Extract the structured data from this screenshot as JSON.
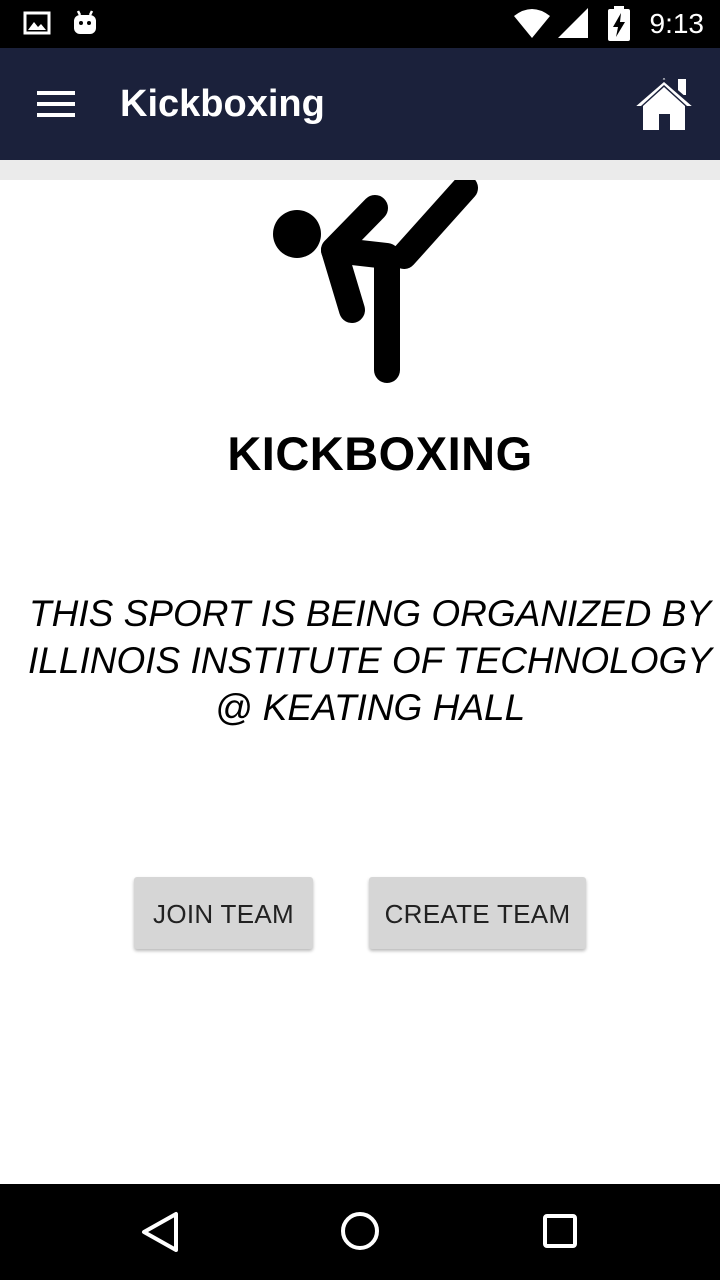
{
  "status_bar": {
    "time": "9:13",
    "icons": [
      "gallery-icon",
      "android-icon",
      "wifi-icon",
      "signal-icon",
      "battery-charging-icon"
    ]
  },
  "toolbar": {
    "title": "Kickboxing",
    "menu_icon": "hamburger-menu-icon",
    "home_icon": "home-icon",
    "background": "#1b213b"
  },
  "sport": {
    "icon": "kickboxing-figure-icon",
    "title": "KICKBOXING",
    "description": "THIS SPORT IS BEING ORGANIZED BY ILLINOIS INSTITUTE OF TECHNOLOGY @ KEATING HALL"
  },
  "actions": {
    "join_label": "JOIN TEAM",
    "create_label": "CREATE TEAM"
  },
  "nav_bar": {
    "icons": [
      "back-icon",
      "home-circle-icon",
      "recents-icon"
    ]
  }
}
